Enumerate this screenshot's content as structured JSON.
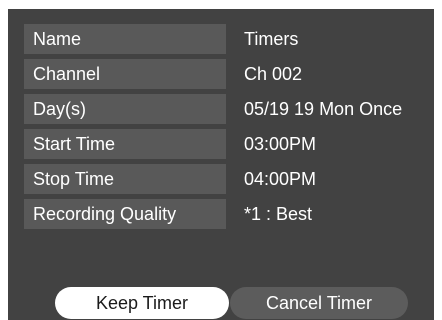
{
  "fields": [
    {
      "label": "Name",
      "value": "Timers"
    },
    {
      "label": "Channel",
      "value": "Ch 002"
    },
    {
      "label": "Day(s)",
      "value": "05/19 19 Mon Once"
    },
    {
      "label": "Start Time",
      "value": "03:00PM"
    },
    {
      "label": "Stop Time",
      "value": "04:00PM"
    },
    {
      "label": "Recording Quality",
      "value": "*1 : Best"
    }
  ],
  "buttons": {
    "keep_label": "Keep Timer",
    "cancel_label": "Cancel Timer"
  },
  "colors": {
    "panel_background": "#424242",
    "label_background": "#595959",
    "text": "#ffffff",
    "selected_button": "#ffffff",
    "unselected_button": "#5c5c5c"
  }
}
